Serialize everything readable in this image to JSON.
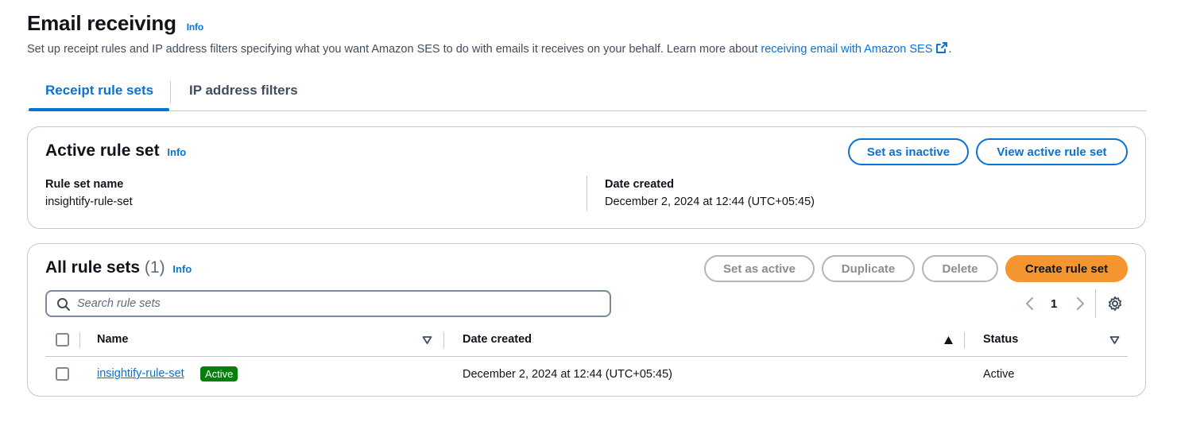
{
  "header": {
    "title": "Email receiving",
    "info": "Info",
    "description": "Set up receipt rules and IP address filters specifying what you want Amazon SES to do with emails it receives on your behalf. Learn more about ",
    "learn_more_link": "receiving email with Amazon SES",
    "description_end": "."
  },
  "tabs": [
    {
      "label": "Receipt rule sets",
      "active": true
    },
    {
      "label": "IP address filters",
      "active": false
    }
  ],
  "active_rule_set": {
    "title": "Active rule set",
    "info": "Info",
    "buttons": {
      "set_inactive": "Set as inactive",
      "view_active": "View active rule set"
    },
    "fields": [
      {
        "label": "Rule set name",
        "value": "insightify-rule-set"
      },
      {
        "label": "Date created",
        "value": "December 2, 2024 at 12:44 (UTC+05:45)"
      }
    ]
  },
  "all_rule_sets": {
    "title": "All rule sets",
    "count": "(1)",
    "info": "Info",
    "buttons": {
      "set_active": "Set as active",
      "duplicate": "Duplicate",
      "delete": "Delete",
      "create": "Create rule set"
    },
    "search_placeholder": "Search rule sets",
    "pagination": {
      "current_page": "1"
    },
    "columns": [
      "Name",
      "Date created",
      "Status"
    ],
    "rows": [
      {
        "name": "insightify-rule-set",
        "badge": "Active",
        "date_created": "December 2, 2024 at 12:44 (UTC+05:45)",
        "status": "Active"
      }
    ]
  },
  "colors": {
    "link_blue": "#0972d3",
    "primary_orange": "#f5952f",
    "badge_green": "#037f0c",
    "border_gray": "#c6c6cd"
  },
  "icons": [
    "external-link-icon",
    "search-icon",
    "chevron-left-icon",
    "chevron-right-icon",
    "settings-gear-icon",
    "sort-descending-icon",
    "sort-ascending-icon"
  ]
}
